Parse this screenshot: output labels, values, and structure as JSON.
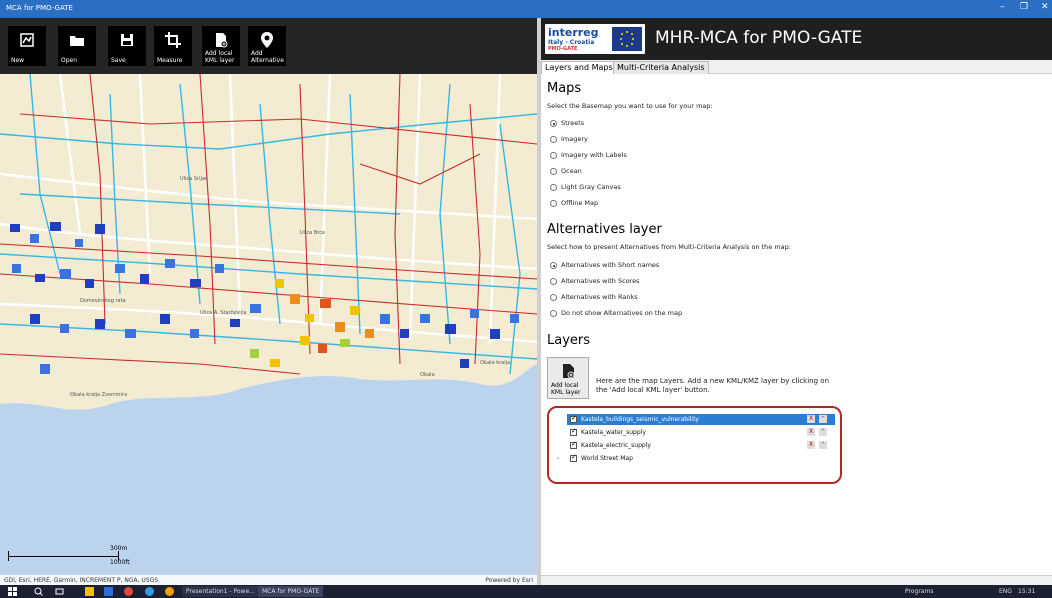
{
  "window": {
    "title": "MCA for PMO-GATE",
    "controls": [
      "–",
      "❐",
      "✕"
    ]
  },
  "toolbar": {
    "buttons": [
      {
        "label": "New",
        "icon": "new-map-icon"
      },
      {
        "label": "Open",
        "icon": "folder-icon"
      },
      {
        "label": "Save",
        "icon": "save-icon"
      },
      {
        "label": "Measure",
        "icon": "crop-icon"
      },
      {
        "label": "Add local KML layer",
        "icon": "add-file-icon"
      },
      {
        "label": "Add Alternative",
        "icon": "map-pin-icon"
      }
    ]
  },
  "map": {
    "attribution": "GDi, Esri, HERE, Garmin, INCREMENT P, NGA, USGS",
    "powered_by": "Powered by Esri",
    "scale_m": "300m",
    "scale_ft": "1000ft",
    "street_labels": [
      "Ulica Srijan",
      "Obala kralja Zvonimira",
      "Ulica Brce",
      "Domovinskog rata",
      "Ulica A. Starčevića",
      "Obala",
      "Obala kralja"
    ],
    "colors": {
      "land": "#f3ecd2",
      "sea": "#bcd3ee",
      "water_lines": "#36b7e3",
      "electric_lines": "#c82b2b",
      "roads": "#ffffff"
    }
  },
  "brand": {
    "logo_line1": "interreg",
    "logo_line2": "Italy - Croatia",
    "logo_line3": "PMO-GATE",
    "title": "MHR-MCA for PMO-GATE"
  },
  "tabs": [
    {
      "label": "Layers and Maps",
      "active": true
    },
    {
      "label": "Multi-Criteria Analysis",
      "active": false
    }
  ],
  "maps_section": {
    "heading": "Maps",
    "desc": "Select the Basemap you want to use for your map:",
    "options": [
      {
        "label": "Streets",
        "selected": true
      },
      {
        "label": "Imagery",
        "selected": false
      },
      {
        "label": "Imagery with Labels",
        "selected": false
      },
      {
        "label": "Ocean",
        "selected": false
      },
      {
        "label": "Light Gray Canvas",
        "selected": false
      },
      {
        "label": "Offline Map",
        "selected": false
      }
    ]
  },
  "alternatives_section": {
    "heading": "Alternatives layer",
    "desc": "Select how to present Alternatives from Multi-Criteria Analysis on the map:",
    "options": [
      {
        "label": "Alternatives with Short names",
        "selected": true
      },
      {
        "label": "Alternatives with Scores",
        "selected": false
      },
      {
        "label": "Alternatives with Ranks",
        "selected": false
      },
      {
        "label": "Do not show Alternatives on the map",
        "selected": false
      }
    ]
  },
  "layers_section": {
    "heading": "Layers",
    "add_button_label": "Add local KML layer",
    "note": "Here are the map Layers. Add a new KML/KMZ layer by clicking on the 'Add local KML layer' button.",
    "layers": [
      {
        "name": "Kastela_buildings_seismic_vulnerability",
        "checked": true,
        "selected": true,
        "remove": "X",
        "move": "^"
      },
      {
        "name": "Kastela_water_supply",
        "checked": true,
        "selected": false,
        "remove": "X",
        "move": "^"
      },
      {
        "name": "Kastela_electric_supply",
        "checked": true,
        "selected": false,
        "remove": "X",
        "move": "^"
      },
      {
        "name": "World Street Map",
        "checked": true,
        "selected": false,
        "expander": "›"
      }
    ]
  },
  "taskbar": {
    "items": [
      "Presentation1 - Powe...",
      "MCA for PMO-GATE"
    ],
    "tray": {
      "programs": "Programs",
      "lang": "ENG",
      "time": "15:31"
    }
  }
}
